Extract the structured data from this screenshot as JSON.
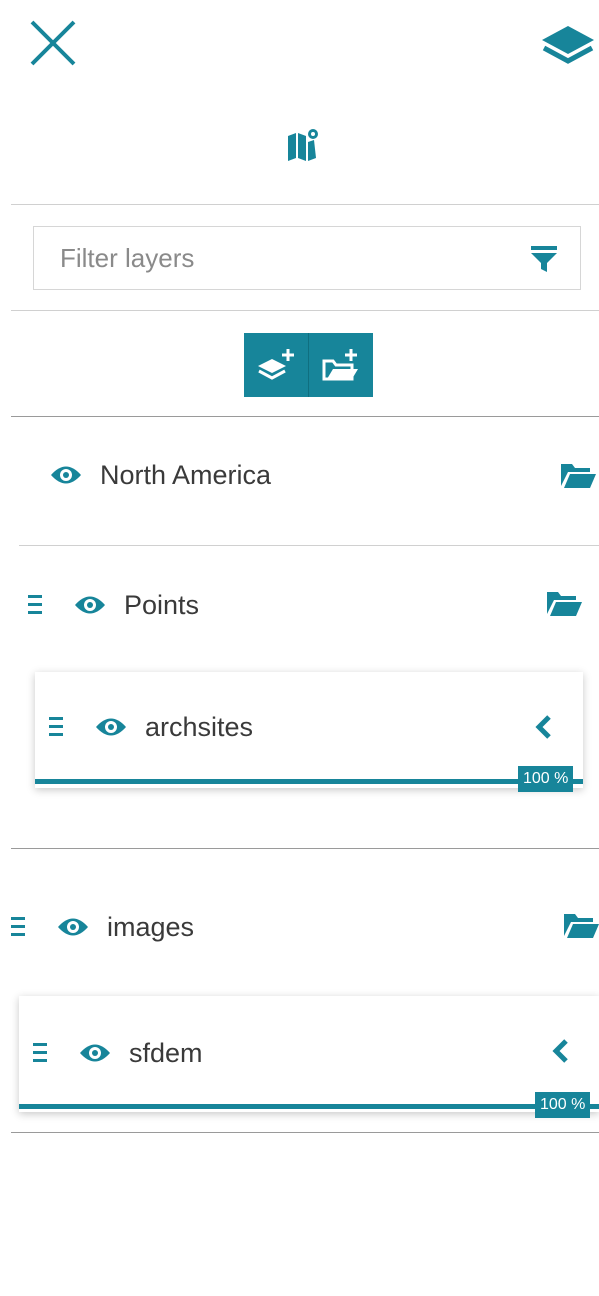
{
  "header": {
    "close_icon": "close-icon",
    "layers_icon": "layers-icon",
    "catalog_icon": "map-marker-icon"
  },
  "filter": {
    "placeholder": "Filter layers",
    "value": "",
    "icon": "filter-icon"
  },
  "toolbar": {
    "add_layer_icon": "add-layer-icon",
    "add_group_icon": "add-folder-icon"
  },
  "tree": {
    "group_north_america": {
      "label": "North America"
    },
    "group_points": {
      "label": "Points"
    },
    "layer_archsites": {
      "label": "archsites",
      "opacity": "100 %",
      "opacity_value": 1.0
    },
    "group_images": {
      "label": "images"
    },
    "layer_sfdem": {
      "label": "sfdem",
      "opacity": "100 %",
      "opacity_value": 1.0
    }
  },
  "colors": {
    "accent": "#17859a",
    "divider": "#d0d0d0"
  }
}
